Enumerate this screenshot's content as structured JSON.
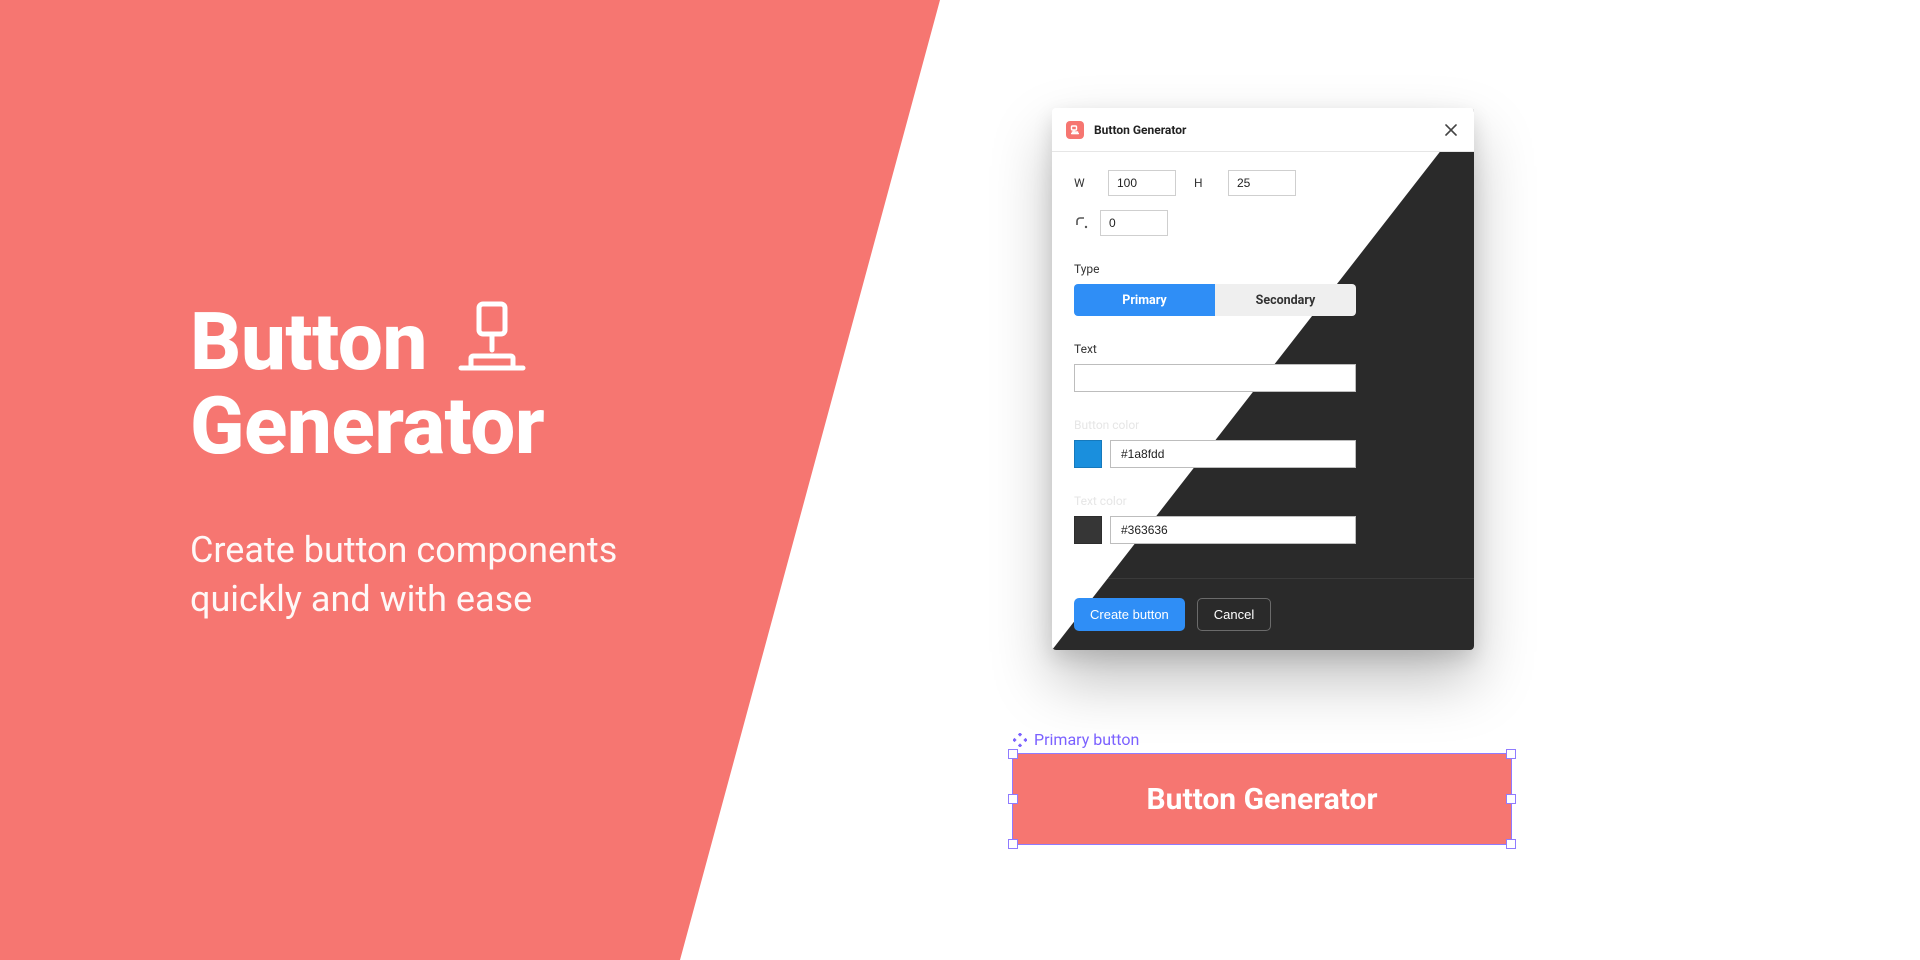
{
  "hero": {
    "title_line1": "Button",
    "title_line2": "Generator",
    "subtitle_line1": "Create button components",
    "subtitle_line2": "quickly and with ease"
  },
  "panel": {
    "title": "Button Generator",
    "width_label": "W",
    "width_value": "100",
    "height_label": "H",
    "height_value": "25",
    "radius_value": "0",
    "type_label": "Type",
    "type_primary": "Primary",
    "type_secondary": "Secondary",
    "text_label": "Text",
    "text_value": "",
    "button_color_label": "Button color",
    "button_color_value": "#1a8fdd",
    "text_color_label": "Text color",
    "text_color_value": "#363636",
    "create_label": "Create button",
    "cancel_label": "Cancel"
  },
  "selection": {
    "label": "Primary button",
    "button_text": "Button Generator"
  }
}
